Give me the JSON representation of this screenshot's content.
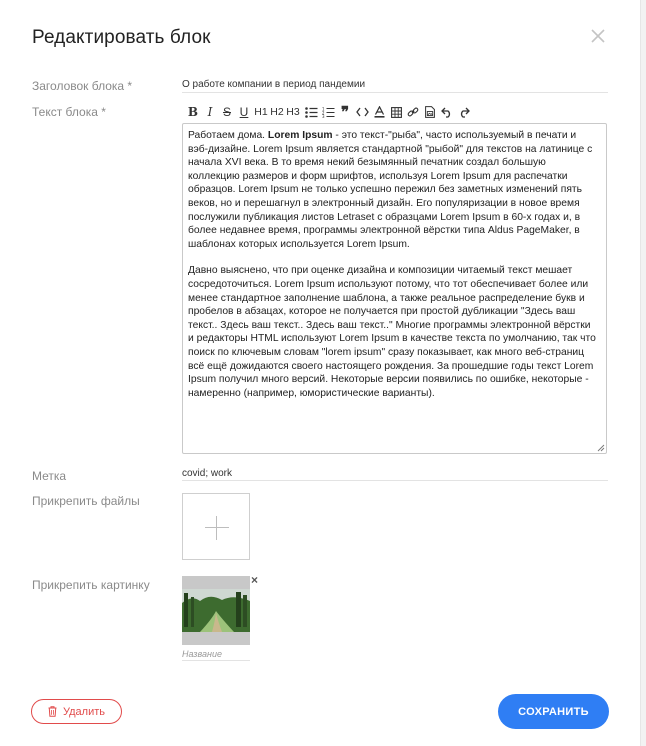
{
  "modal": {
    "title": "Редактировать блок"
  },
  "form": {
    "block_title_label": "Заголовок блока *",
    "block_title_value": "О работе компании в период пандемии",
    "block_text_label": "Текст блока *",
    "tag_label": "Метка",
    "tag_value": "covid; work",
    "attach_files_label": "Прикрепить файлы",
    "attach_image_label": "Прикрепить картинку",
    "image_name_placeholder": "Название"
  },
  "toolbar": {
    "items": [
      "bold",
      "italic",
      "strikethrough",
      "underline",
      "H1",
      "H2",
      "H3",
      "bullet-list",
      "numbered-list",
      "blockquote",
      "code",
      "text-color",
      "table",
      "link",
      "image",
      "undo",
      "redo"
    ],
    "h1": "H1",
    "h2": "H2",
    "h3": "H3"
  },
  "editor": {
    "p1_lead": "Работаем дома. ",
    "p1_bold": "Lorem Ipsum",
    "p1_rest": " - это текст-\"рыба\", часто используемый в печати и вэб-дизайне. Lorem Ipsum является стандартной \"рыбой\" для текстов на латинице с начала XVI века. В то время некий безымянный печатник создал большую коллекцию размеров и форм шрифтов, используя Lorem Ipsum для распечатки образцов. Lorem Ipsum не только успешно пережил без заметных изменений пять веков, но и перешагнул в электронный дизайн. Его популяризации в новое время послужили публикация листов Letraset с образцами Lorem Ipsum в 60-х годах и, в более недавнее время, программы электронной вёрстки типа Aldus PageMaker, в шаблонах которых используется Lorem Ipsum.",
    "p2": "Давно выяснено, что при оценке дизайна и композиции читаемый текст мешает сосредоточиться. Lorem Ipsum используют потому, что тот обеспечивает более или менее стандартное заполнение шаблона, а также реальное распределение букв и пробелов в абзацах, которое не получается при простой дубликации \"Здесь ваш текст.. Здесь ваш текст.. Здесь ваш текст..\" Многие программы электронной вёрстки и редакторы HTML используют Lorem Ipsum в качестве текста по умолчанию, так что поиск по ключевым словам \"lorem ipsum\" сразу показывает, как много веб-страниц всё ещё дожидаются своего настоящего рождения. За прошедшие годы текст Lorem Ipsum получил много версий. Некоторые версии появились по ошибке, некоторые - намеренно (например, юмористические варианты)."
  },
  "buttons": {
    "delete_label": "Удалить",
    "save_label": "СОХРАНИТЬ"
  },
  "colors": {
    "accent": "#2f7ef4",
    "danger": "#e14b4b",
    "label": "#8a8a8a"
  }
}
